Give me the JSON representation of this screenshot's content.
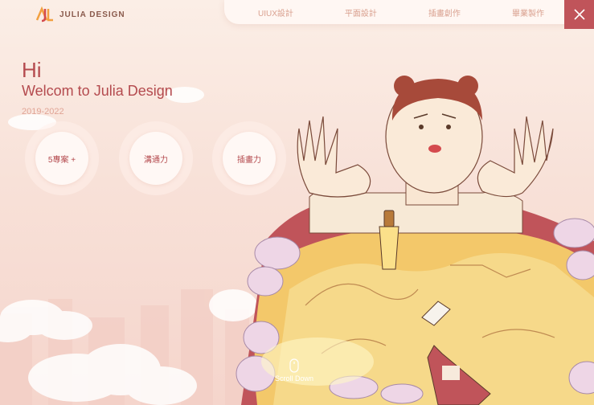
{
  "brand": {
    "name": "JULIA DESIGN",
    "logo_letters": "JL"
  },
  "nav": {
    "items": [
      "UIUX設計",
      "平面設計",
      "插畫創作",
      "畢業製作"
    ]
  },
  "hero": {
    "greeting": "Hi",
    "welcome": "Welcom to Julia Design",
    "years": "2019-2022"
  },
  "skills": [
    "5專案 +",
    "溝通力",
    "插畫力"
  ],
  "scroll": {
    "label": "Scroll Down"
  },
  "colors": {
    "accent": "#b44a4e",
    "close_bg": "#c0545a",
    "nav_text": "#d9a08f"
  },
  "icons": {
    "close": "close-icon",
    "mouse": "mouse-icon"
  }
}
